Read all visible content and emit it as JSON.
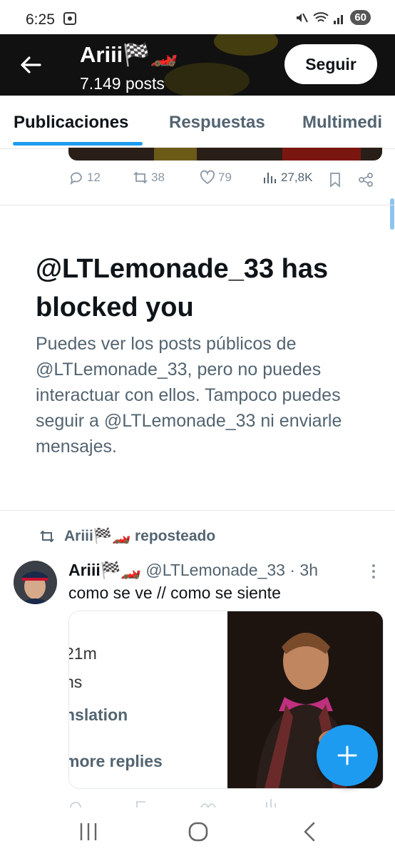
{
  "status_bar": {
    "time": "6:25",
    "battery": "60"
  },
  "header": {
    "name": "Ariii🏁🏎️",
    "posts": "7.149 posts",
    "follow_label": "Seguir"
  },
  "tabs": [
    {
      "label": "Publicaciones",
      "active": true
    },
    {
      "label": "Respuestas",
      "active": false
    },
    {
      "label": "Multimedi",
      "active": false
    }
  ],
  "prev_post_actions": {
    "replies": "12",
    "reposts": "38",
    "likes": "79",
    "views": "27,8K"
  },
  "blocked": {
    "title": "@LTLemonade_33 has blocked you",
    "body": "Puedes ver los posts públicos de @LTLemonade_33, pero no puedes interactuar con ellos. Tampoco puedes seguir a @LTLemonade_33 ni enviarle mensajes."
  },
  "repost": {
    "label": "Ariii🏁🏎️ reposteado",
    "author_name": "Ariii🏁🏎️",
    "author_handle": "@LTLemonade_33 · 3h",
    "text": "como se ve // como se siente",
    "media_left_lines": [
      "21m",
      "ns",
      "nslation",
      "more replies"
    ]
  },
  "colors": {
    "accent": "#1d9bf0",
    "header_bg": "#111111",
    "muted": "#536471"
  }
}
